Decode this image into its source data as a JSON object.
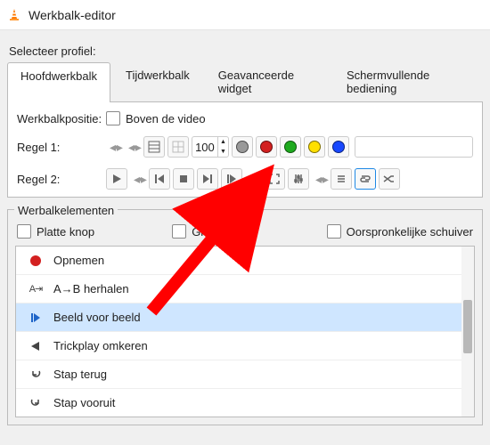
{
  "title": "Werkbalk-editor",
  "profile_label": "Selecteer profiel:",
  "tabs": [
    "Hoofdwerkbalk",
    "Tijdwerkbalk",
    "Geavanceerde widget",
    "Schermvullende bediening"
  ],
  "active_tab": 0,
  "position_label": "Werkbalkpositie:",
  "above_video": "Boven de video",
  "line1_label": "Regel 1:",
  "line2_label": "Regel 2:",
  "zoom_value": "100",
  "dot_colors": [
    "#999999",
    "#d32020",
    "#1eaa1e",
    "#ffe000",
    "#1848ff"
  ],
  "elements_label": "Werbalkelementen",
  "flat_button": "Platte knop",
  "big_button": "Grote knop",
  "orig_slider": "Oorspronkelijke schuiver",
  "list": [
    {
      "icon": "record",
      "label": "Opnemen"
    },
    {
      "icon": "ab",
      "label": "A→B herhalen"
    },
    {
      "icon": "frame",
      "label": "Beeld voor beeld"
    },
    {
      "icon": "rev",
      "label": "Trickplay omkeren"
    },
    {
      "icon": "stepb",
      "label": "Stap terug"
    },
    {
      "icon": "stepf",
      "label": "Stap vooruit"
    }
  ]
}
